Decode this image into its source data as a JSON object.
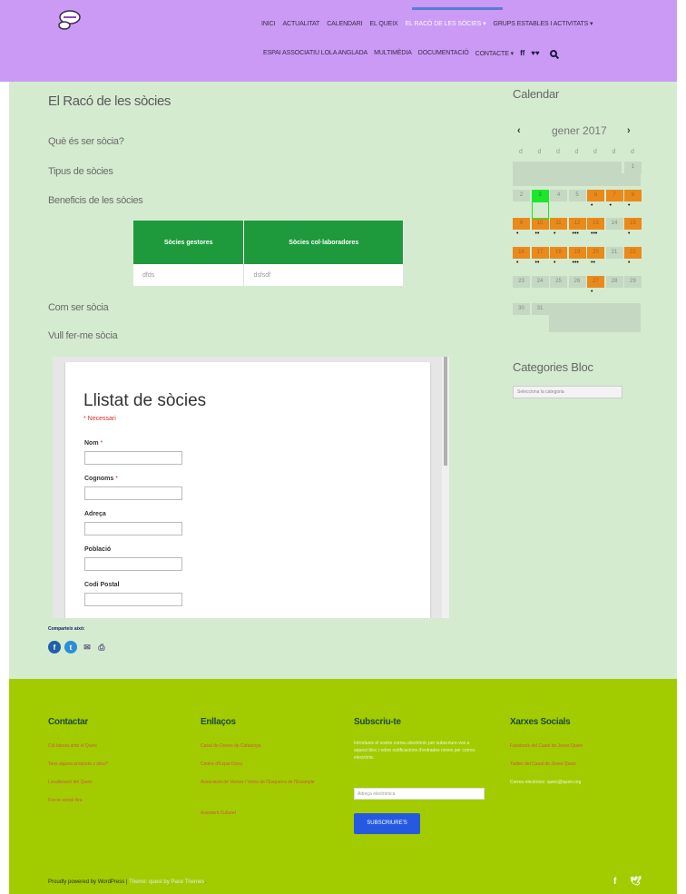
{
  "nav": {
    "row1": [
      "INICI",
      "ACTUALITAT",
      "CALENDARI",
      "EL QUEIX",
      "EL RACÓ DE LES SÒCIES ▾",
      "GRUPS ESTABLES I ACTIVITATS ▾"
    ],
    "row2": [
      "ESPAI ASSOCIATIU LOLA ANGLADA",
      "MULTIMÈDIA",
      "DOCUMENTACIÓ",
      "CONTACTE ▾"
    ],
    "icons": {
      "facebook": "f",
      "twitter": "🐦",
      "search": ""
    }
  },
  "page": {
    "title": "El Racó de les sòcies",
    "sections": [
      "Què és ser sòcia?",
      "Tipus de sòcies",
      "Beneficis de les sòcies",
      "Com ser sòcia",
      "Vull fer-me sòcia"
    ]
  },
  "table": {
    "headers": [
      "Sòcies gestores",
      "Sòcies col·laboradores"
    ],
    "rows": [
      [
        "dfds",
        "dsfsdf"
      ]
    ]
  },
  "form": {
    "title": "Llistat de sòcies",
    "required_note": "* Necessari",
    "fields": [
      {
        "label": "Nom",
        "required": true
      },
      {
        "label": "Cognoms",
        "required": true
      },
      {
        "label": "Adreça",
        "required": false
      },
      {
        "label": "Població",
        "required": false
      },
      {
        "label": "Codi Postal",
        "required": false
      }
    ]
  },
  "share": {
    "label": "Comparteix això:",
    "buttons": [
      "facebook",
      "twitter",
      "email",
      "print"
    ]
  },
  "sidebar": {
    "calendar_title": "Calendar",
    "month": "gener 2017",
    "prev": "‹",
    "next": "›",
    "dow": [
      "d",
      "d",
      "d",
      "d",
      "d",
      "d",
      "d"
    ],
    "categories_title": "Categories Bloc",
    "categories_placeholder": "Selecciona la categoria"
  },
  "calendar_days": [
    1,
    2,
    3,
    4,
    5,
    6,
    7,
    8,
    9,
    10,
    11,
    12,
    13,
    14,
    15,
    16,
    17,
    18,
    19,
    20,
    21,
    22,
    23,
    24,
    25,
    26,
    27,
    28,
    29,
    30,
    31
  ],
  "calendar_event_days": [
    6,
    7,
    8,
    9,
    10,
    11,
    12,
    13,
    15,
    16,
    17,
    18,
    19,
    20,
    22,
    27
  ],
  "calendar_today": 3,
  "footer": {
    "contact_title": "Contactar",
    "contact_links": [
      "Col·labora amb el Queix",
      "Tens alguna proposta o idea?",
      "Localització del Queix",
      "Fes-te sòcia! Ara"
    ],
    "links_title": "Enllaços",
    "links": [
      "Casal de Dones de Catalunya",
      "Centre d'Espai Dona",
      "Associació de Veïnes i Veïns de l'Esquerra de l'Eixample",
      "Assistent Culturel"
    ],
    "subscribe_title": "Subscriu-te",
    "subscribe_text": "Introdueix el vostre correu electrònic per subscriure-vos a aquest bloc i rebre notificacions d'entrades noves per correu electrònic.",
    "email_placeholder": "Adreça electrònica",
    "subscribe_button": "SUBSCRIURE'S",
    "social_title": "Xarxes Socials",
    "social_links": [
      "Facebook del Casal de Joves Queix",
      "Twitter del Casal de Joves Queix"
    ],
    "social_email": "Correu electrònic: queix@queix.org",
    "credits_a": "Proudly powered by WordPress",
    "credits_sep": " | ",
    "credits_b": "Theme: quest by",
    "credits_c": "Pace Themes",
    "credits_end": "."
  },
  "colors": {
    "header": "#ca9af4",
    "content": "#d5ebd0",
    "footer": "#a2cc00",
    "table_header": "#1e9a3c",
    "event": "#ea8a1b",
    "today": "#1ee62d",
    "button": "#2659e0"
  }
}
